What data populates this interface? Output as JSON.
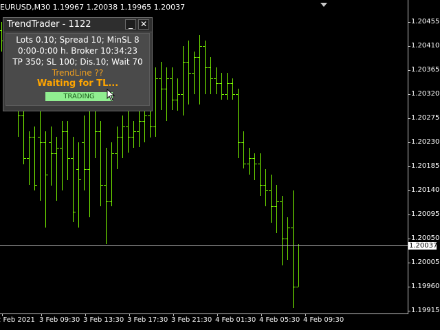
{
  "header": {
    "symbol_info": "EURUSD,M30  1.19967 1.20038 1.19965 1.20037"
  },
  "price_axis": [
    {
      "label": "1.20455",
      "price": 1.20455
    },
    {
      "label": "1.20410",
      "price": 1.2041
    },
    {
      "label": "1.20365",
      "price": 1.20365
    },
    {
      "label": "1.20320",
      "price": 1.2032
    },
    {
      "label": "1.20275",
      "price": 1.20275
    },
    {
      "label": "1.20230",
      "price": 1.2023
    },
    {
      "label": "1.20185",
      "price": 1.20185
    },
    {
      "label": "1.20140",
      "price": 1.2014
    },
    {
      "label": "1.20095",
      "price": 1.20095
    },
    {
      "label": "1.20050",
      "price": 1.2005
    },
    {
      "label": "1.20005",
      "price": 1.20005
    },
    {
      "label": "1.19960",
      "price": 1.1996
    },
    {
      "label": "1.19915",
      "price": 1.19915
    }
  ],
  "time_axis": [
    "2 Feb 2021",
    "3 Feb 09:30",
    "3 Feb 13:30",
    "3 Feb 17:30",
    "3 Feb 21:30",
    "4 Feb 01:30",
    "4 Feb 05:30",
    "4 Feb 09:30"
  ],
  "bid": {
    "label": "1.20037",
    "price": 1.20037
  },
  "colors": {
    "bars": "#7cfc00",
    "axis": "#c8c8c8",
    "panel_bg": "#3a3a3a",
    "accent_orange": "#ffa500",
    "button_green": "#90ee90"
  },
  "chart_data": {
    "type": "ohlc",
    "series": [
      {
        "values": [
          [
            1.2044,
            1.20455,
            1.204,
            1.2042
          ],
          [
            1.2043,
            1.2044,
            1.2033,
            1.2035
          ],
          [
            1.2035,
            1.2037,
            1.2029,
            1.203
          ],
          [
            1.203,
            1.2032,
            1.2024,
            1.2028
          ],
          [
            1.2028,
            1.203,
            1.2019,
            1.202
          ],
          [
            1.202,
            1.2025,
            1.2015,
            1.2024
          ],
          [
            1.2024,
            1.2026,
            1.2014,
            1.2015
          ],
          [
            1.2024,
            1.2033,
            1.2012,
            1.2023
          ],
          [
            1.2023,
            1.2025,
            1.2007,
            1.2017
          ],
          [
            1.2023,
            1.2026,
            1.2015,
            1.2021
          ],
          [
            1.2021,
            1.2024,
            1.2012,
            1.2022
          ],
          [
            1.2022,
            1.2027,
            1.2014,
            1.2025
          ],
          [
            1.2025,
            1.2027,
            1.2016,
            1.202
          ],
          [
            1.202,
            1.2024,
            1.2008,
            1.201
          ],
          [
            1.2018,
            1.2023,
            1.2007,
            1.2016
          ],
          [
            1.2023,
            1.2028,
            1.2014,
            1.2018
          ],
          [
            1.2018,
            1.2032,
            1.2009,
            1.2029
          ],
          [
            1.2029,
            1.2033,
            1.202,
            1.2025
          ],
          [
            1.2025,
            1.2027,
            1.2011,
            1.2015
          ],
          [
            1.2015,
            1.2022,
            1.2004,
            1.2012
          ],
          [
            1.2012,
            1.2023,
            1.2011,
            1.2021
          ],
          [
            1.2021,
            1.2026,
            1.2018,
            1.2024
          ],
          [
            1.2024,
            1.2028,
            1.202,
            1.2026
          ],
          [
            1.2026,
            1.2029,
            1.2021,
            1.2024
          ],
          [
            1.2024,
            1.2027,
            1.2022,
            1.2025
          ],
          [
            1.2025,
            1.2029,
            1.2022,
            1.2027
          ],
          [
            1.2027,
            1.203,
            1.2023,
            1.2028
          ],
          [
            1.2028,
            1.203,
            1.2024,
            1.2026
          ],
          [
            1.2026,
            1.2037,
            1.2024,
            1.2035
          ],
          [
            1.2035,
            1.2038,
            1.2029,
            1.2033
          ],
          [
            1.2033,
            1.2037,
            1.2027,
            1.2035
          ],
          [
            1.2035,
            1.2037,
            1.2029,
            1.2031
          ],
          [
            1.2031,
            1.2035,
            1.2029,
            1.2032
          ],
          [
            1.2032,
            1.2041,
            1.2028,
            1.2038
          ],
          [
            1.2038,
            1.2042,
            1.203,
            1.2036
          ],
          [
            1.2036,
            1.204,
            1.2032,
            1.2039
          ],
          [
            1.2039,
            1.2043,
            1.203,
            1.2041
          ],
          [
            1.2041,
            1.2042,
            1.2032,
            1.2037
          ],
          [
            1.2037,
            1.2039,
            1.2032,
            1.2035
          ],
          [
            1.2035,
            1.2037,
            1.2032,
            1.2034
          ],
          [
            1.2034,
            1.2036,
            1.2031,
            1.2032
          ],
          [
            1.2032,
            1.2036,
            1.2031,
            1.2034
          ],
          [
            1.2034,
            1.2035,
            1.2031,
            1.2032
          ],
          [
            1.2032,
            1.2033,
            1.202,
            1.2023
          ],
          [
            1.2023,
            1.2025,
            1.2018,
            1.2019
          ],
          [
            1.2019,
            1.2022,
            1.2017,
            1.202
          ],
          [
            1.202,
            1.2021,
            1.2016,
            1.2019
          ],
          [
            1.2019,
            1.2021,
            1.2013,
            1.2015
          ],
          [
            1.2015,
            1.2018,
            1.2011,
            1.2014
          ],
          [
            1.2014,
            1.2017,
            1.2008,
            1.2011
          ],
          [
            1.2011,
            1.2015,
            1.2006,
            1.2012
          ],
          [
            1.2012,
            1.2013,
            1.2,
            1.2005
          ],
          [
            1.2005,
            1.2009,
            1.2001,
            1.2007
          ],
          [
            1.2007,
            1.2014,
            1.1992,
            1.1996
          ],
          [
            1.1996,
            1.2004,
            1.1996,
            1.20037
          ]
        ]
      }
    ],
    "ylim": [
      1.19915,
      1.20455
    ],
    "grid": false
  },
  "panel": {
    "title": "TrendTrader - 1122",
    "minimize_label": "_",
    "close_label": "✕",
    "line1": "Lots 0.10; Spread 10; MinSL 8",
    "line2": "0:00-0:00 h. Broker 10:34:23",
    "line3": "TP 350; SL 100; Dis.10; Wait 70",
    "trendline": "TrendLine ??",
    "waiting": "Waiting for TL...",
    "trading_button": "TRADING"
  }
}
